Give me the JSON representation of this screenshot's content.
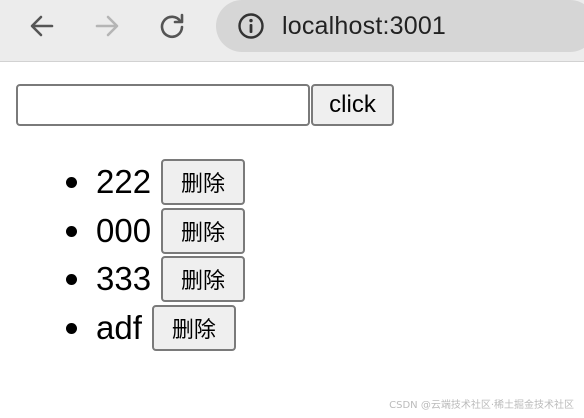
{
  "browser": {
    "url": "localhost:3001",
    "icons": {
      "back": "back-arrow-icon",
      "forward": "forward-arrow-icon",
      "reload": "reload-icon",
      "info": "info-icon"
    },
    "colors": {
      "toolbar_bg": "#ececec",
      "omnibox_bg": "#d6d6d6",
      "icon_active": "#555555",
      "icon_disabled": "#b5b5b5"
    }
  },
  "form": {
    "input_value": "",
    "button_label": "click"
  },
  "list": {
    "items": [
      {
        "text": "222",
        "delete_label": "删除"
      },
      {
        "text": "000",
        "delete_label": "删除"
      },
      {
        "text": "333",
        "delete_label": "删除"
      },
      {
        "text": "adf",
        "delete_label": "删除"
      }
    ]
  },
  "watermark": "CSDN @云端技术社区·稀土掘金技术社区"
}
